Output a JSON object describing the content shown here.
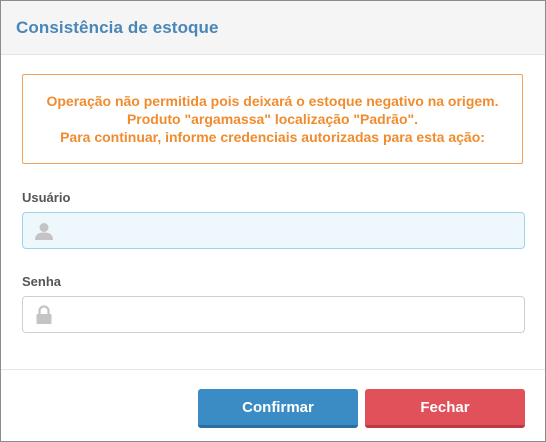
{
  "dialog": {
    "title": "Consistência de estoque"
  },
  "alert": {
    "line1": "Operação não permitida pois deixará o estoque negativo na origem.",
    "line2": "Produto \"argamassa\" localização \"Padrão\".",
    "line3": "Para continuar, informe credenciais autorizadas para esta ação:",
    "color": "#f08c2e"
  },
  "form": {
    "user_label": "Usuário",
    "user_value": "",
    "user_icon": "user-icon",
    "password_label": "Senha",
    "password_value": "",
    "password_icon": "lock-icon"
  },
  "buttons": {
    "confirm_label": "Confirmar",
    "close_label": "Fechar",
    "confirm_color": "#3b8cc4",
    "close_color": "#e0515a"
  }
}
